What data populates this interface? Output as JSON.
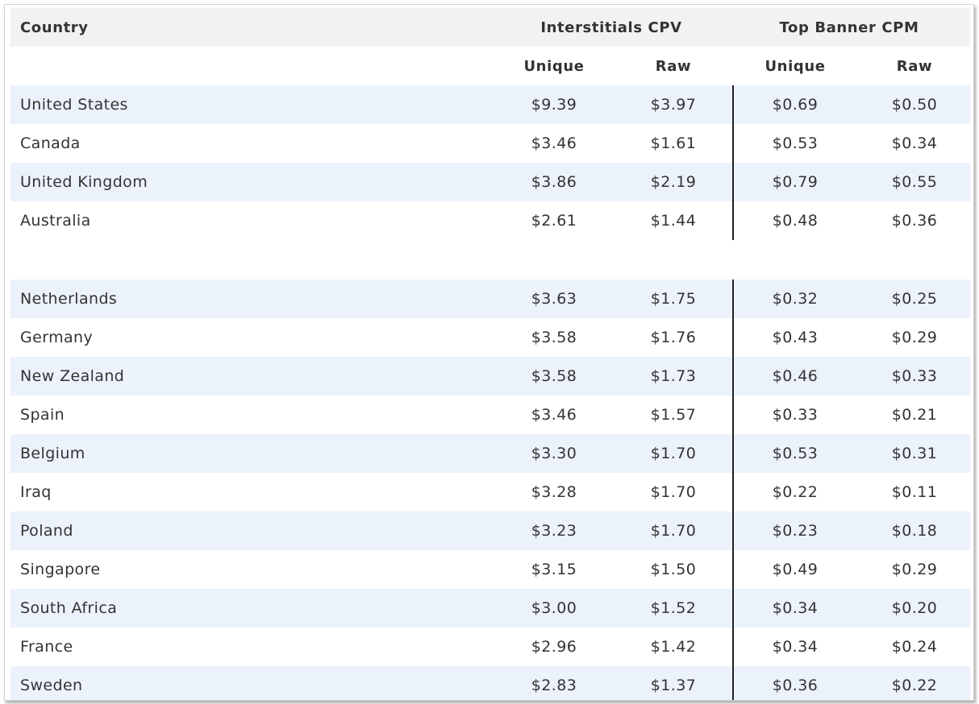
{
  "header": {
    "country_label": "Country",
    "group_interstitials": "Interstitials CPV",
    "group_top_banner": "Top Banner CPM",
    "sub_unique_1": "Unique",
    "sub_raw_1": "Raw",
    "sub_unique_2": "Unique",
    "sub_raw_2": "Raw"
  },
  "group_a": [
    {
      "country": "United States",
      "int_unique": "$9.39",
      "int_raw": "$3.97",
      "top_unique": "$0.69",
      "top_raw": "$0.50"
    },
    {
      "country": "Canada",
      "int_unique": "$3.46",
      "int_raw": "$1.61",
      "top_unique": "$0.53",
      "top_raw": "$0.34"
    },
    {
      "country": "United Kingdom",
      "int_unique": "$3.86",
      "int_raw": "$2.19",
      "top_unique": "$0.79",
      "top_raw": "$0.55"
    },
    {
      "country": "Australia",
      "int_unique": "$2.61",
      "int_raw": "$1.44",
      "top_unique": "$0.48",
      "top_raw": "$0.36"
    }
  ],
  "group_b": [
    {
      "country": "Netherlands",
      "int_unique": "$3.63",
      "int_raw": "$1.75",
      "top_unique": "$0.32",
      "top_raw": "$0.25"
    },
    {
      "country": "Germany",
      "int_unique": "$3.58",
      "int_raw": "$1.76",
      "top_unique": "$0.43",
      "top_raw": "$0.29"
    },
    {
      "country": "New Zealand",
      "int_unique": "$3.58",
      "int_raw": "$1.73",
      "top_unique": "$0.46",
      "top_raw": "$0.33"
    },
    {
      "country": "Spain",
      "int_unique": "$3.46",
      "int_raw": "$1.57",
      "top_unique": "$0.33",
      "top_raw": "$0.21"
    },
    {
      "country": "Belgium",
      "int_unique": "$3.30",
      "int_raw": "$1.70",
      "top_unique": "$0.53",
      "top_raw": "$0.31"
    },
    {
      "country": "Iraq",
      "int_unique": "$3.28",
      "int_raw": "$1.70",
      "top_unique": "$0.22",
      "top_raw": "$0.11"
    },
    {
      "country": "Poland",
      "int_unique": "$3.23",
      "int_raw": "$1.70",
      "top_unique": "$0.23",
      "top_raw": "$0.18"
    },
    {
      "country": "Singapore",
      "int_unique": "$3.15",
      "int_raw": "$1.50",
      "top_unique": "$0.49",
      "top_raw": "$0.29"
    },
    {
      "country": "South Africa",
      "int_unique": "$3.00",
      "int_raw": "$1.52",
      "top_unique": "$0.34",
      "top_raw": "$0.20"
    },
    {
      "country": "France",
      "int_unique": "$2.96",
      "int_raw": "$1.42",
      "top_unique": "$0.34",
      "top_raw": "$0.24"
    },
    {
      "country": "Sweden",
      "int_unique": "$2.83",
      "int_raw": "$1.37",
      "top_unique": "$0.36",
      "top_raw": "$0.22"
    }
  ],
  "colors": {
    "band": "#ecf2fc",
    "header_band": "#f2f2f2",
    "divider": "#222222",
    "text": "#333333"
  }
}
